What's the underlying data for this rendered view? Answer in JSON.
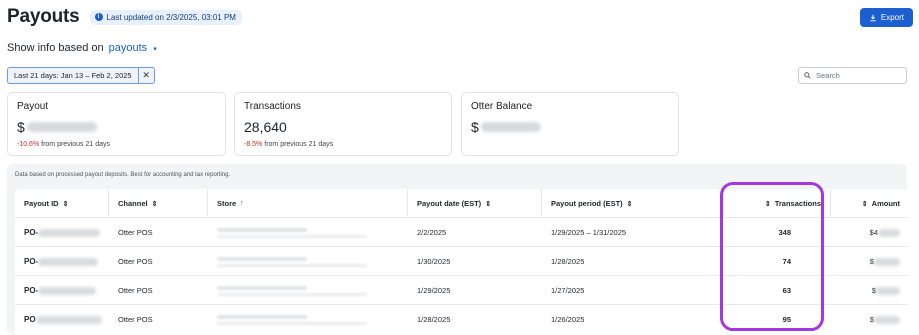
{
  "header": {
    "title": "Payouts",
    "updated": "Last updated on 2/3/2025, 03:01 PM",
    "export_label": "Export"
  },
  "filter": {
    "show_info_label": "Show info based on",
    "show_info_value": "payouts",
    "date_chip": "Last 21 days: Jan 13 – Feb 2, 2025",
    "search_placeholder": "Search"
  },
  "cards": [
    {
      "title": "Payout",
      "value_prefix": "$",
      "delta": "-10.6%",
      "delta_text": "from previous 21 days"
    },
    {
      "title": "Transactions",
      "value": "28,640",
      "delta": "-8.5%",
      "delta_text": "from previous 21 days"
    },
    {
      "title": "Otter Balance",
      "value_prefix": "$"
    }
  ],
  "table": {
    "note": "Data based on processed payout deposits. Best for accounting and tax reporting.",
    "columns": {
      "payout_id": "Payout ID",
      "channel": "Channel",
      "store": "Store",
      "payout_date": "Payout date (EST)",
      "payout_period": "Payout period (EST)",
      "transactions": "Transactions",
      "amount": "Amount"
    },
    "rows": [
      {
        "id": "PO-",
        "channel": "Otter POS",
        "date": "2/2/2025",
        "period": "1/29/2025 – 1/31/2025",
        "transactions": "348",
        "amount": "$4"
      },
      {
        "id": "PO-",
        "channel": "Otter POS",
        "date": "1/30/2025",
        "period": "1/28/2025",
        "transactions": "74",
        "amount": "$"
      },
      {
        "id": "PO-",
        "channel": "Otter POS",
        "date": "1/29/2025",
        "period": "1/27/2025",
        "transactions": "63",
        "amount": "$"
      },
      {
        "id": "PO",
        "channel": "Otter POS",
        "date": "1/28/2025",
        "period": "1/26/2025",
        "transactions": "95",
        "amount": "$"
      }
    ]
  },
  "colors": {
    "accent": "#1c5fd0",
    "negative": "#d12a2a",
    "highlight": "#a238e0"
  }
}
